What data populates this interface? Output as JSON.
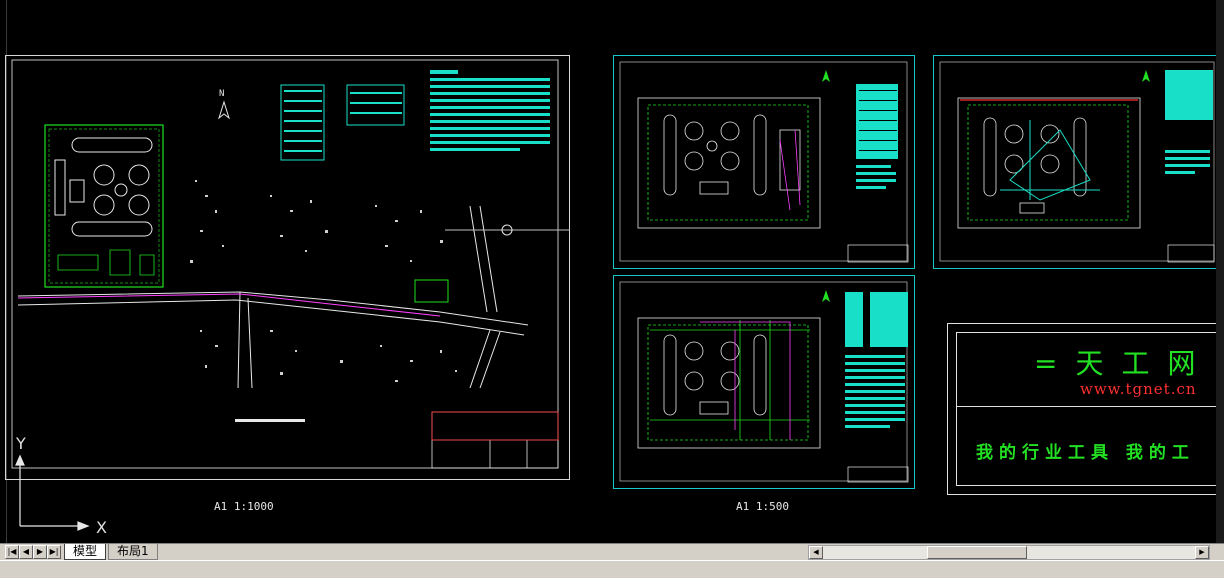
{
  "window": {
    "accent_cyan": "#18c8c8",
    "green": "#22e022",
    "red": "#ff3030",
    "background": "#000000"
  },
  "drawing": {
    "left_scale_label": "A1    1:1000",
    "right_scale_label": "A1    1:500",
    "north_label": "N"
  },
  "ucs": {
    "y_label": "Y",
    "x_label": "X"
  },
  "watermark": {
    "title": "=天工网",
    "url": "www.tgnet.cn",
    "slogan": "我的行业工具 我的工"
  },
  "tabs": {
    "model": "模型",
    "layout1": "布局1"
  },
  "nav_icons": [
    "first-arrow-icon",
    "prev-arrow-icon",
    "next-arrow-icon",
    "last-arrow-icon"
  ]
}
